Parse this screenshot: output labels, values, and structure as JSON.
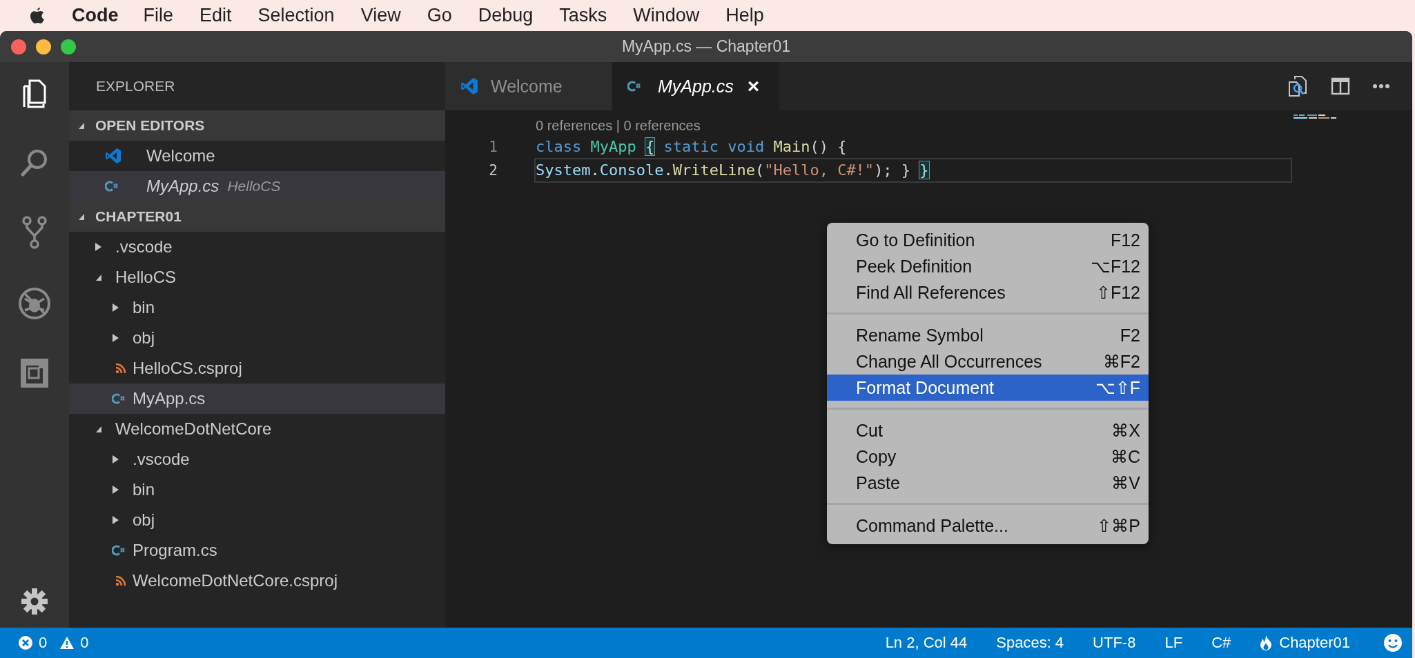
{
  "menubar": {
    "app": "Code",
    "items": [
      "File",
      "Edit",
      "Selection",
      "View",
      "Go",
      "Debug",
      "Tasks",
      "Window",
      "Help"
    ]
  },
  "window": {
    "title": "MyApp.cs — Chapter01"
  },
  "activity_bar": [
    {
      "kind": "explorer",
      "selected": true
    },
    {
      "kind": "search",
      "selected": false
    },
    {
      "kind": "scm",
      "selected": false
    },
    {
      "kind": "debug",
      "selected": false
    },
    {
      "kind": "extensions",
      "selected": false
    }
  ],
  "sidebar": {
    "title": "EXPLORER",
    "sections": [
      {
        "title": "OPEN EDITORS",
        "expanded": true,
        "items": [
          {
            "label": "Welcome",
            "kind": "welcome",
            "preview": false,
            "selected": false
          },
          {
            "label": "MyApp.cs",
            "kind": "cs",
            "description": "HelloCS",
            "preview": true,
            "selected": true
          }
        ]
      },
      {
        "title": "CHAPTER01",
        "expanded": true,
        "tree": [
          {
            "label": ".vscode",
            "kind": "folder",
            "expanded": false,
            "selected": false
          },
          {
            "label": "HelloCS",
            "kind": "folder",
            "expanded": true,
            "selected": false,
            "children": [
              {
                "label": "bin",
                "kind": "folder",
                "expanded": false,
                "selected": false
              },
              {
                "label": "obj",
                "kind": "folder",
                "expanded": false,
                "selected": false
              },
              {
                "label": "HelloCS.csproj",
                "kind": "csproj",
                "selected": false
              },
              {
                "label": "MyApp.cs",
                "kind": "cs",
                "selected": true
              }
            ]
          },
          {
            "label": "WelcomeDotNetCore",
            "kind": "folder",
            "expanded": true,
            "selected": false,
            "children": [
              {
                "label": ".vscode",
                "kind": "folder",
                "expanded": false,
                "selected": false
              },
              {
                "label": "bin",
                "kind": "folder",
                "expanded": false,
                "selected": false
              },
              {
                "label": "obj",
                "kind": "folder",
                "expanded": false,
                "selected": false
              },
              {
                "label": "Program.cs",
                "kind": "cs",
                "selected": false
              },
              {
                "label": "WelcomeDotNetCore.csproj",
                "kind": "csproj",
                "selected": false
              }
            ]
          }
        ]
      }
    ]
  },
  "tabs": [
    {
      "label": "Welcome",
      "kind": "welcome",
      "selected": false,
      "preview": false
    },
    {
      "label": "MyApp.cs",
      "kind": "cs",
      "selected": true,
      "preview": true,
      "close": "×"
    }
  ],
  "editor": {
    "codelens": "0 references | 0 references",
    "lines": [
      {
        "number": "1",
        "current": false,
        "tokens": [
          {
            "text": "class",
            "kind": "keyword"
          },
          {
            "text": " MyApp ",
            "kind": "type"
          },
          {
            "text": "{",
            "kind": "bracket-match"
          },
          {
            "text": " static",
            "kind": "keyword"
          },
          {
            "text": " void",
            "kind": "keyword"
          },
          {
            "text": " Main",
            "kind": "function"
          },
          {
            "text": "() {",
            "kind": "plain"
          }
        ]
      },
      {
        "number": "2",
        "current": true,
        "tokens": [
          {
            "text": "System",
            "kind": "variable"
          },
          {
            "text": ".",
            "kind": "plain"
          },
          {
            "text": "Console",
            "kind": "variable"
          },
          {
            "text": ".",
            "kind": "plain"
          },
          {
            "text": "WriteLine",
            "kind": "function"
          },
          {
            "text": "(",
            "kind": "plain"
          },
          {
            "text": "\"Hello, C#!\"",
            "kind": "string"
          },
          {
            "text": "); } ",
            "kind": "plain"
          },
          {
            "text": "}",
            "kind": "bracket-match"
          }
        ]
      }
    ]
  },
  "context_menu": {
    "groups": [
      [
        {
          "label": "Go to Definition",
          "shortcut": "F12",
          "selected": false
        },
        {
          "label": "Peek Definition",
          "shortcut": "⌥F12",
          "selected": false
        },
        {
          "label": "Find All References",
          "shortcut": "⇧F12",
          "selected": false
        }
      ],
      [
        {
          "label": "Rename Symbol",
          "shortcut": "F2",
          "selected": false
        },
        {
          "label": "Change All Occurrences",
          "shortcut": "⌘F2",
          "selected": false
        },
        {
          "label": "Format Document",
          "shortcut": "⌥⇧F",
          "selected": true
        }
      ],
      [
        {
          "label": "Cut",
          "shortcut": "⌘X",
          "selected": false
        },
        {
          "label": "Copy",
          "shortcut": "⌘C",
          "selected": false
        },
        {
          "label": "Paste",
          "shortcut": "⌘V",
          "selected": false
        }
      ],
      [
        {
          "label": "Command Palette...",
          "shortcut": "⇧⌘P",
          "selected": false
        }
      ]
    ]
  },
  "status_bar": {
    "errors": "0",
    "warnings": "0",
    "right": [
      {
        "text": "Ln 2, Col 44",
        "kind": "text"
      },
      {
        "text": "Spaces: 4",
        "kind": "text"
      },
      {
        "text": "UTF-8",
        "kind": "text"
      },
      {
        "text": "LF",
        "kind": "text"
      },
      {
        "text": "C#",
        "kind": "text"
      },
      {
        "text": "Chapter01",
        "kind": "project"
      }
    ]
  }
}
